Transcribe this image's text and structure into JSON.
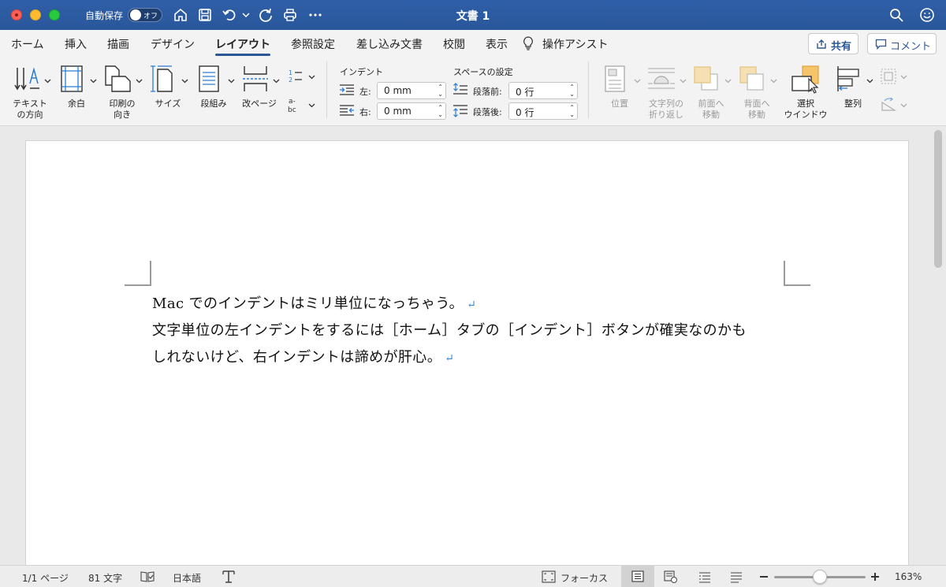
{
  "titlebar": {
    "autosave_label": "自動保存",
    "autosave_toggle": "オフ",
    "document_title": "文書 1"
  },
  "tabs": [
    {
      "label": "ホーム"
    },
    {
      "label": "挿入"
    },
    {
      "label": "描画"
    },
    {
      "label": "デザイン"
    },
    {
      "label": "レイアウト"
    },
    {
      "label": "参照設定"
    },
    {
      "label": "差し込み文書"
    },
    {
      "label": "校閲"
    },
    {
      "label": "表示"
    },
    {
      "label": "操作アシスト"
    }
  ],
  "active_tab": "レイアウト",
  "header_buttons": {
    "share": "共有",
    "comment": "コメント"
  },
  "ribbon": {
    "page_setup": {
      "text_direction": {
        "line1": "テキスト",
        "line2": "の方向"
      },
      "margins": "余白",
      "orientation": {
        "line1": "印刷の",
        "line2": "向き"
      },
      "size": "サイズ",
      "columns": "段組み",
      "breaks": "改ページ"
    },
    "indent": {
      "title": "インデント",
      "left_label": "左:",
      "left_value": "0 mm",
      "right_label": "右:",
      "right_value": "0 mm"
    },
    "spacing": {
      "title": "スペースの設定",
      "before_label": "段落前:",
      "before_value": "0 行",
      "after_label": "段落後:",
      "after_value": "0 行"
    },
    "arrange": {
      "position": "位置",
      "wrap_text": {
        "line1": "文字列の",
        "line2": "折り返し"
      },
      "bring_forward": {
        "line1": "前面へ",
        "line2": "移動"
      },
      "send_backward": {
        "line1": "背面へ",
        "line2": "移動"
      },
      "selection_pane": {
        "line1": "選択",
        "line2": "ウインドウ"
      },
      "align": "整列"
    }
  },
  "document": {
    "lines": [
      "Mac でのインデントはミリ単位になっちゃう。",
      "文字単位の左インデントをするには［ホーム］タブの［インデント］ボタンが確実なのかも",
      "しれないけど、右インデントは諦めが肝心。"
    ],
    "pilcrow": "↵"
  },
  "statusbar": {
    "page": "1/1 ページ",
    "words": "81 文字",
    "language": "日本語",
    "focus": "フォーカス",
    "zoom": "163%",
    "zoom_fraction": 0.5
  },
  "colors": {
    "title_bar": "#2b5797",
    "accent": "#2b5797",
    "pilcrow": "#3b88d8"
  }
}
